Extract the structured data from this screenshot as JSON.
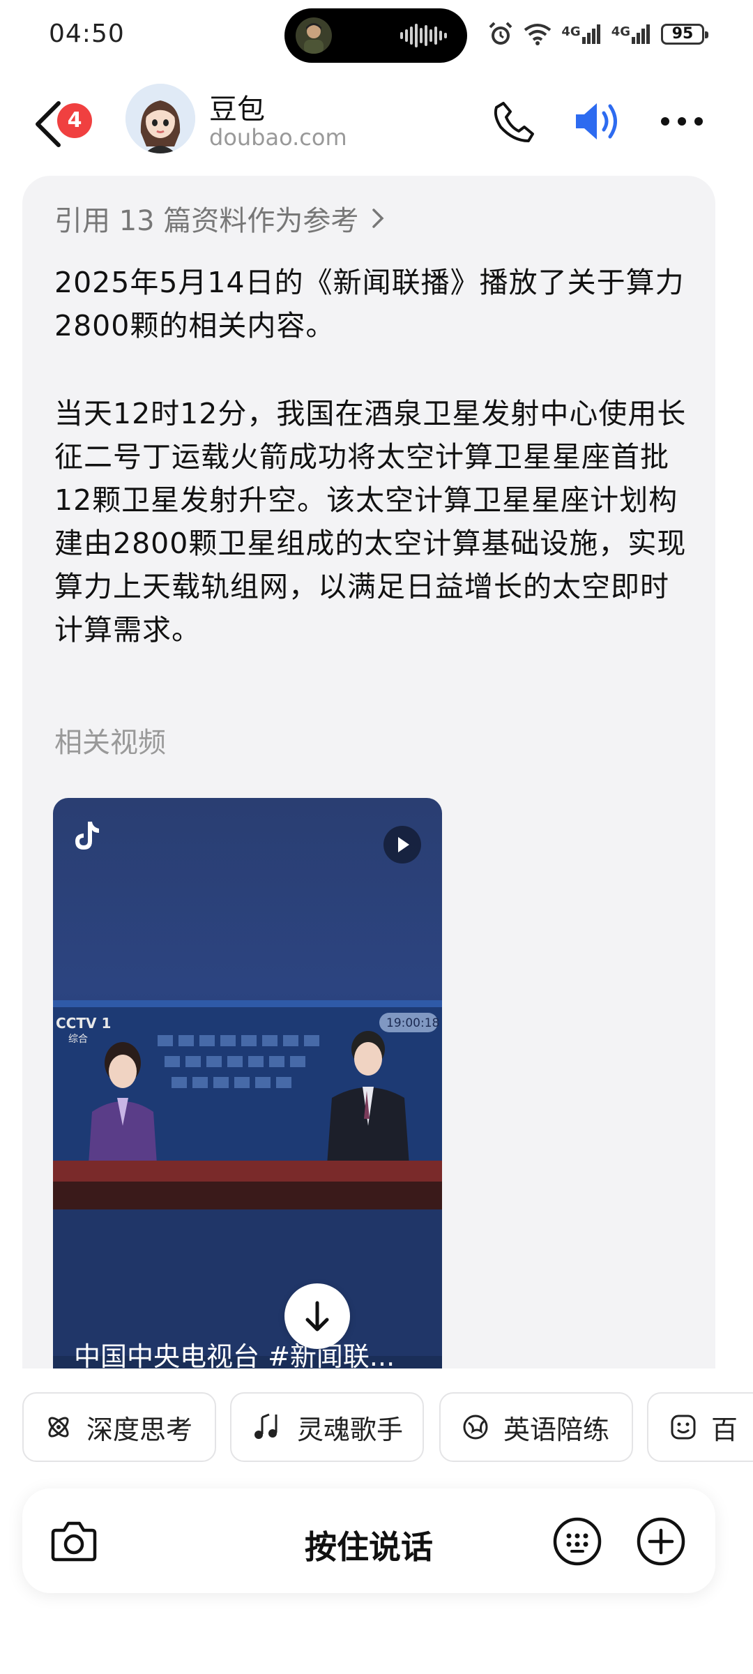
{
  "status_bar": {
    "time": "04:50",
    "battery": "95",
    "network_1": "4G",
    "network_2": "4G"
  },
  "header": {
    "unread_badge": "4",
    "bot_name": "豆包",
    "bot_domain": "doubao.com"
  },
  "message": {
    "references_label": "引用 13 篇资料作为参考",
    "paragraph_1": "2025年5月14日的《新闻联播》播放了关于算力2800颗的相关内容。",
    "paragraph_2": "当天12时12分，我国在酒泉卫星发射中心使用长征二号丁运载火箭成功将太空计算卫星星座首批12颗卫星发射升空。该太空计算卫星星座计划构建由2800颗卫星组成的太空计算基础设施，实现算力上天载轨组网，以满足日益增长的太空即时计算需求。",
    "related_videos_title": "相关视频",
    "video": {
      "caption": "中国中央电视台 #新闻联...",
      "channel_logo": "CCTV 1",
      "channel_sub": "综合",
      "clock": "19:00:18"
    }
  },
  "chips": [
    {
      "label": "深度思考",
      "icon": "atom-icon"
    },
    {
      "label": "灵魂歌手",
      "icon": "music-note-icon"
    },
    {
      "label": "英语陪练",
      "icon": "globe-icon"
    },
    {
      "label": "百",
      "icon": "smile-icon"
    }
  ],
  "input_bar": {
    "hold_to_talk_label": "按住说话"
  },
  "colors": {
    "accent_blue": "#2d6bf0",
    "badge_red": "#f04040",
    "card_bg": "#f3f3f5"
  }
}
